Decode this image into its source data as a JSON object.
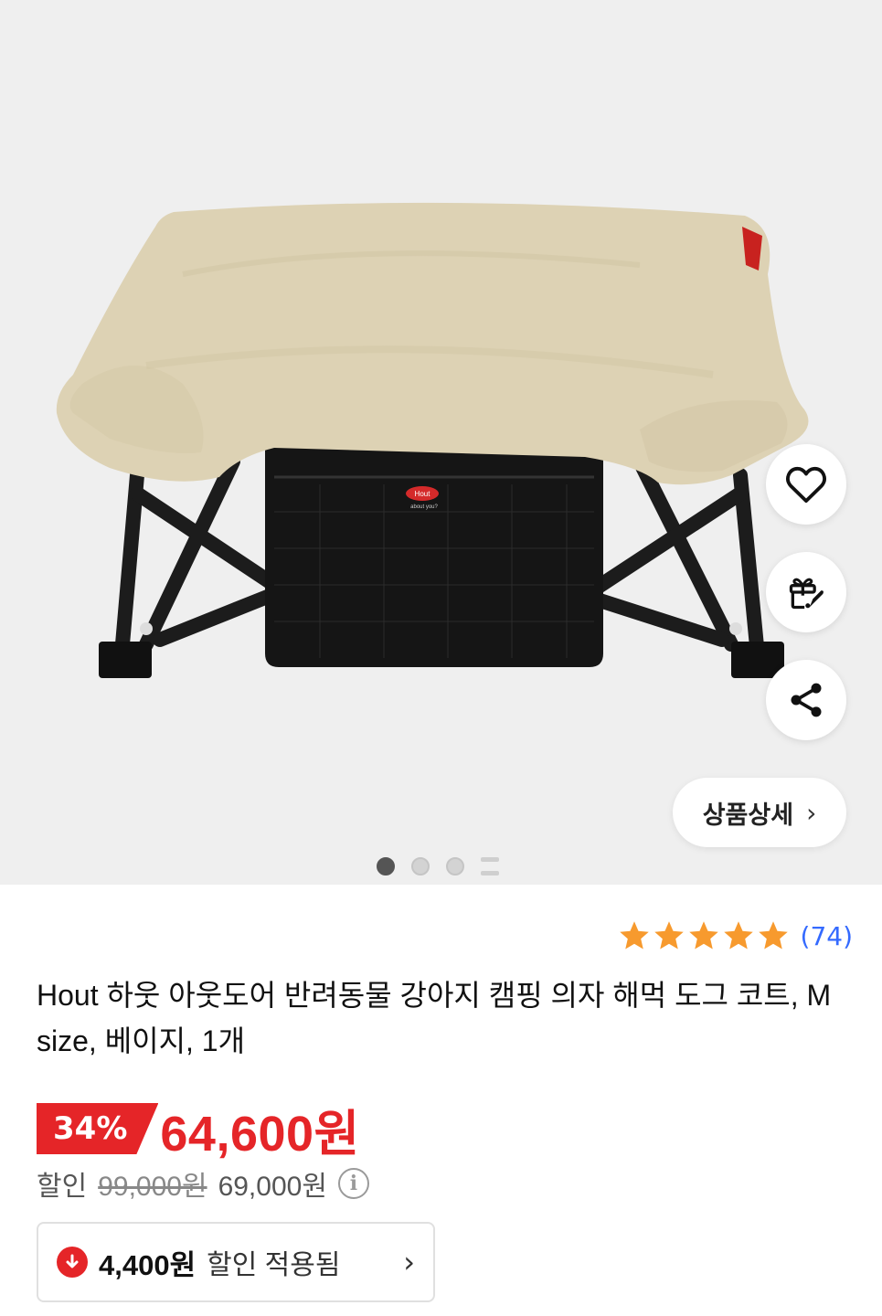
{
  "product": {
    "image_alt": "beige dog camping cot with black mesh pocket",
    "brand_tag": "Hout",
    "brand_tag_sub": "about you?",
    "title": "Hout 하웃 아웃도어 반려동물 강아지 캠핑 의자 해먹 도그 코트, M size, 베이지, 1개"
  },
  "actions": {
    "like_icon": "heart-icon",
    "gift_icon": "gift-rocket-icon",
    "share_icon": "share-icon",
    "detail_label": "상품상세",
    "detail_chevron": "›"
  },
  "pager": {
    "count": 3,
    "active_index": 0
  },
  "rating": {
    "stars": 5,
    "count_text": "(74)",
    "star_color": "#f79a2e"
  },
  "price": {
    "discount_pct": "34%",
    "sale_price": "64,600원",
    "discount_label": "할인",
    "original_price": "99,000원",
    "base_price": "69,000원",
    "info_icon": "i"
  },
  "coupon": {
    "amount": "4,400원",
    "text": "할인 적용됨",
    "chevron": "›"
  },
  "colors": {
    "accent_red": "#e52528",
    "link_blue": "#346aff"
  }
}
